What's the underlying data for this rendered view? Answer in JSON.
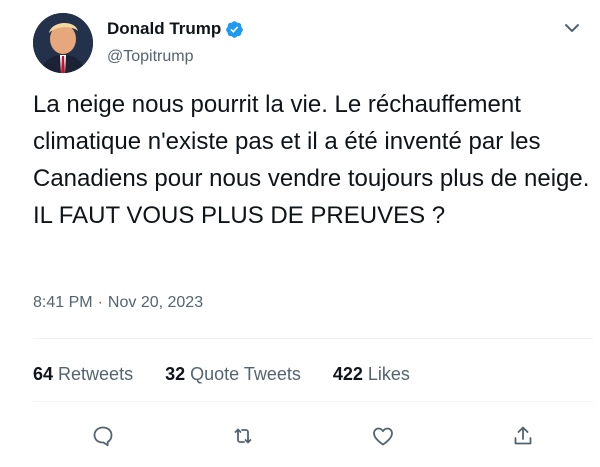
{
  "author": {
    "display_name": "Donald Trump",
    "handle": "@Topitrump",
    "verified": true
  },
  "tweet": {
    "text": "La neige nous pourrit la vie. Le réchauffement climatique n'existe pas et il a été inventé par les Canadiens pour nous vendre toujours plus de neige. IL FAUT VOUS PLUS DE PREUVES ?",
    "time": "8:41 PM",
    "separator": "·",
    "date": "Nov 20, 2023"
  },
  "stats": {
    "retweets_count": "64",
    "retweets_label": "Retweets",
    "quotes_count": "32",
    "quotes_label": "Quote Tweets",
    "likes_count": "422",
    "likes_label": "Likes"
  },
  "actions": {
    "reply": "reply-icon",
    "retweet": "retweet-icon",
    "like": "heart-icon",
    "share": "share-icon"
  },
  "colors": {
    "text": "#0f1419",
    "secondary": "#536471",
    "verified": "#1d9bf0",
    "divider": "#eff3f4"
  }
}
